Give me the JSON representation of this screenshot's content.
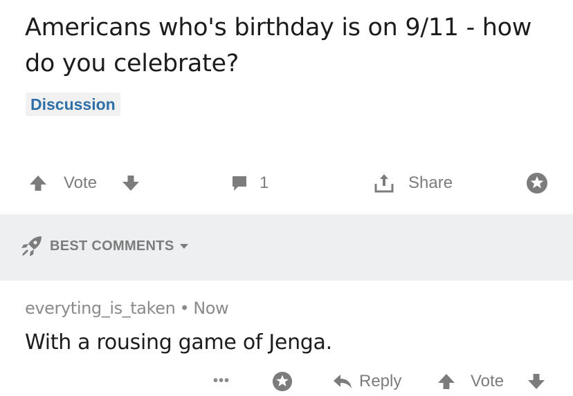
{
  "post": {
    "title": "Americans who's birthday is on 9/11 - how do you celebrate?",
    "flair": "Discussion"
  },
  "actions": {
    "vote_label": "Vote",
    "comment_count": "1",
    "share_label": "Share"
  },
  "comments_header": {
    "sort_label": "BEST COMMENTS"
  },
  "comment": {
    "author": "everyting_is_taken",
    "separator": "•",
    "time": "Now",
    "body": "With a rousing game of Jenga.",
    "more": "•••",
    "reply_label": "Reply",
    "vote_label": "Vote"
  },
  "icons": {
    "upvote": "arrow-up-icon",
    "downvote": "arrow-down-icon",
    "comment": "speech-bubble-icon",
    "share": "share-upload-icon",
    "award": "award-star-icon",
    "sort": "rocket-icon",
    "reply": "reply-arrow-icon"
  },
  "colors": {
    "flair_text": "#2f6fa8",
    "flair_bg": "#f1f1f1",
    "icon_gray": "#7c7c7c",
    "band_bg": "#edeff1"
  }
}
